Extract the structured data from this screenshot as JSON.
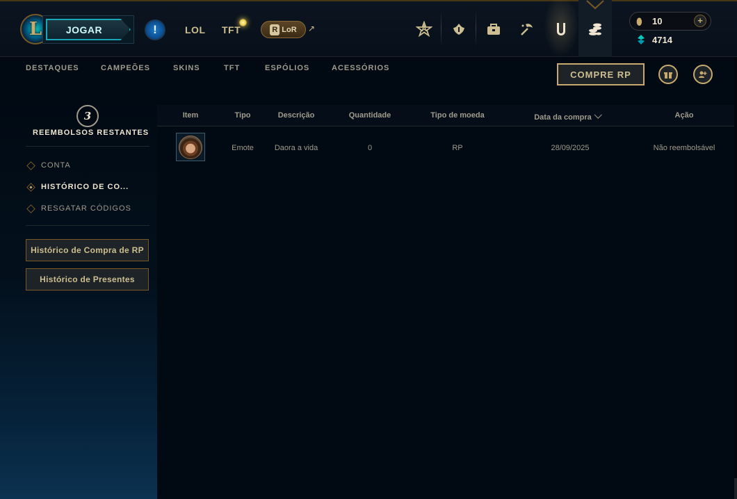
{
  "header": {
    "logo_letter": "L",
    "play_label": "JOGAR",
    "alert_symbol": "!",
    "nav": {
      "lol": "LOL",
      "tft": "TFT"
    },
    "lor": {
      "icon_letter": "R",
      "label": "LoR",
      "external_arrow": "↗"
    },
    "top_icons": [
      "clash-icon",
      "ranked-icon",
      "collection-icon",
      "loot-icon",
      "store-icon",
      "store-history-icon"
    ],
    "currency": {
      "rp_icon": "rp-icon",
      "rp": "10",
      "plus": "+",
      "be_icon": "blue-essence-icon",
      "be": "4714"
    },
    "accent_color": "#c8aa6e",
    "play_color": "#1aa6b7"
  },
  "subnav": {
    "items": [
      "DESTAQUES",
      "CAMPEÕES",
      "SKINS",
      "TFT",
      "ESPÓLIOS",
      "ACESSÓRIOS"
    ],
    "buy_rp_label": "COMPRE RP",
    "gift_icon": "gift-icon",
    "profile_icon": "friend-gift-icon"
  },
  "sidebar": {
    "refunds_count": "3",
    "refunds_label": "REEMBOLSOS RESTANTES",
    "items": [
      {
        "label": "CONTA",
        "active": false
      },
      {
        "label": "HISTÓRICO DE CO...",
        "active": true
      },
      {
        "label": "RESGATAR CÓDIGOS",
        "active": false
      }
    ],
    "buttons": [
      "Histórico de Compra de RP",
      "Histórico de Presentes"
    ]
  },
  "table": {
    "headers": [
      "Item",
      "Tipo",
      "Descrição",
      "Quantidade",
      "Tipo de moeda",
      "Data da compra",
      "Ação"
    ],
    "sorted_column": "Data da compra",
    "rows": [
      {
        "item_icon": "emote-thumbnail",
        "tipo": "Emote",
        "descricao": "Daora a vida",
        "quantidade": "0",
        "tipo_moeda": "RP",
        "data": "28/09/2025",
        "acao": "Não reembolsável"
      }
    ]
  }
}
